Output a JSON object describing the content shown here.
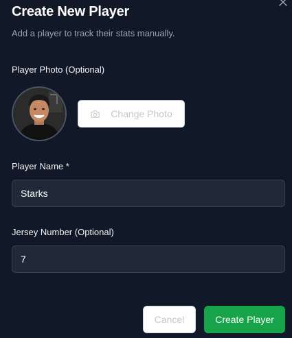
{
  "dialog": {
    "title": "Create New Player",
    "subtitle": "Add a player to track their stats manually.",
    "close_icon": "close-icon"
  },
  "photo": {
    "label": "Player Photo (Optional)",
    "change_label": "Change Photo",
    "button_icon": "camera-icon"
  },
  "name_field": {
    "label": "Player Name *",
    "value": "Starks"
  },
  "jersey_field": {
    "label": "Jersey Number (Optional)",
    "value": "7"
  },
  "actions": {
    "cancel_label": "Cancel",
    "create_label": "Create Player"
  },
  "colors": {
    "background": "#111827",
    "input_background": "#1f2937",
    "primary": "#16a34a"
  }
}
